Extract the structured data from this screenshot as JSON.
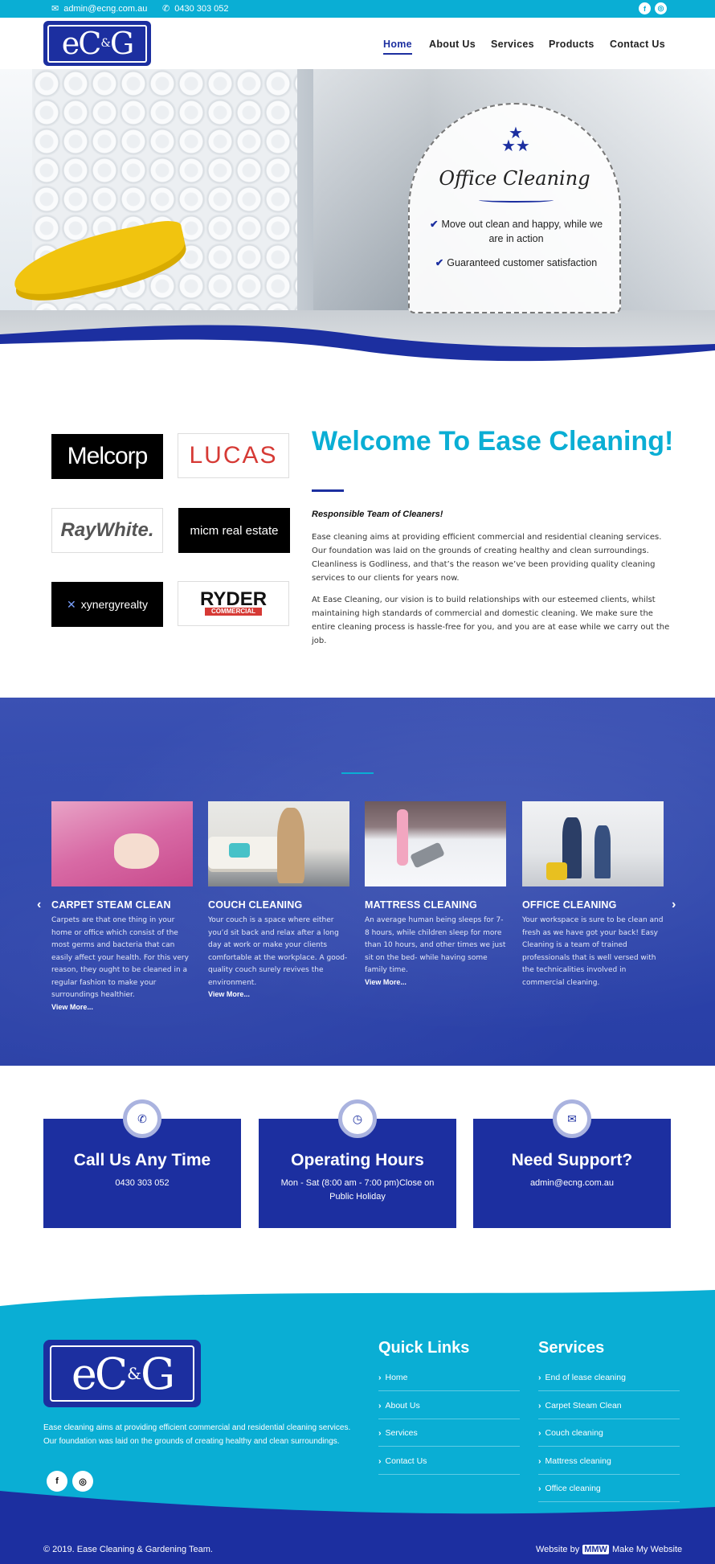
{
  "topbar": {
    "email": "admin@ecng.com.au",
    "phone": "0430 303 052",
    "email_icon": "envelope-icon",
    "phone_icon": "phone-icon",
    "social": [
      "facebook-icon",
      "instagram-icon"
    ]
  },
  "header": {
    "logo_text": "eC",
    "logo_amp": "&",
    "logo_tail": "G",
    "nav": [
      "Home",
      "About Us",
      "Services",
      "Products",
      "Contact Us"
    ],
    "active_nav": "Home"
  },
  "hero": {
    "title": "Office Cleaning",
    "points": [
      "Move out clean and happy, while we are in action",
      "Guaranteed customer satisfaction"
    ]
  },
  "brands": [
    "Melcorp",
    "LUCAS",
    "RayWhite.",
    "micm real estate",
    "xynergyrealty",
    "RYDER"
  ],
  "ryder_sub": "COMMERCIAL",
  "welcome": {
    "title": "Welcome To Ease Cleaning!",
    "subtitle": "Responsible Team of Cleaners!",
    "p1": "Ease cleaning aims at providing efficient commercial and residential cleaning services. Our foundation was laid on the grounds of creating healthy and clean surroundings. Cleanliness is Godliness, and that’s the reason we’ve been providing quality cleaning services to our clients for years now.",
    "p2": "At Ease Cleaning, our vision is to build relationships with our esteemed clients, whilst maintaining high standards of commercial and domestic cleaning. We make sure the entire cleaning process is hassle-free for you, and you are at ease while we carry out the job."
  },
  "services": [
    {
      "name": "CARPET STEAM CLEAN",
      "desc": "Carpets are that one thing in your home or office which consist of the most germs and bacteria that can easily affect your health. For this very reason, they ought to be cleaned in a regular fashion to make your surroundings healthier.",
      "more": "View More..."
    },
    {
      "name": "COUCH CLEANING",
      "desc": "Your couch is a space where either you’d sit back and relax after a long day at work or make your clients comfortable at the workplace. A good-quality couch surely revives the environment.",
      "more": "View More..."
    },
    {
      "name": "MATTRESS CLEANING",
      "desc": "An average human being sleeps for 7-8 hours, while children sleep for more than 10 hours, and other times we just sit on the bed- while having some family time.",
      "more": "View More..."
    },
    {
      "name": "OFFICE CLEANING",
      "desc": "Your workspace is sure to be clean and fresh as we have got your back! Easy Cleaning is a team of trained professionals that is well versed with the technicalities involved in commercial cleaning.",
      "more": ""
    }
  ],
  "info": [
    {
      "title": "Call Us Any Time",
      "value": "0430 303 052",
      "icon": "phone-icon"
    },
    {
      "title": "Operating Hours",
      "value": "Mon - Sat (8:00 am - 7:00 pm)Close on Public Holiday",
      "icon": "clock-icon"
    },
    {
      "title": "Need Support?",
      "value": "admin@ecng.com.au",
      "icon": "envelope-icon"
    }
  ],
  "footer": {
    "desc": "Ease cleaning aims at providing efficient commercial and residential cleaning services. Our foundation was laid on the grounds of creating healthy and clean surroundings.",
    "quick_links_title": "Quick Links",
    "quick_links": [
      "Home",
      "About Us",
      "Services",
      "Contact Us"
    ],
    "services_title": "Services",
    "services": [
      "End of lease cleaning",
      "Carpet Steam Clean",
      "Couch cleaning",
      "Mattress cleaning",
      "Office cleaning"
    ],
    "copyright": "© 2019. Ease Cleaning & Gardening Team.",
    "credit_prefix": "Website by",
    "credit_logo": "MMW",
    "credit_name": "Make My Website"
  },
  "colors": {
    "accent": "#0aaed4",
    "brand": "#1c2fa0"
  }
}
